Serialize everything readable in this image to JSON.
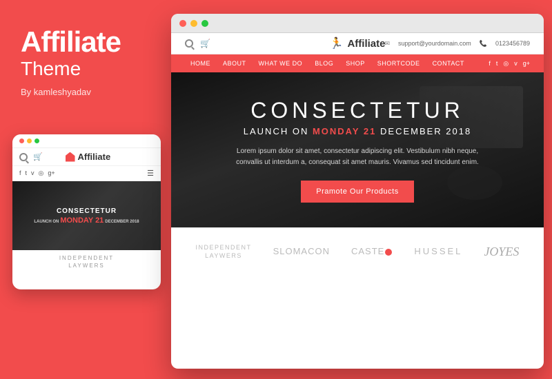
{
  "brand": {
    "title": "Affiliate",
    "subtitle": "Theme",
    "by": "By kamleshyadav"
  },
  "mobile": {
    "logo_text": "Affiliate",
    "hero_title": "CONSECTETUR",
    "hero_launch_prefix": "LAUNCH ON",
    "hero_launch_highlight": "MONDAY 21",
    "hero_launch_suffix": "DECEMBER 2018",
    "brand_bottom_line1": "INDEPENDENT",
    "brand_bottom_line2": "LAYWERS"
  },
  "desktop": {
    "logo_text": "Affiliate",
    "support_email": "support@yourdomain.com",
    "phone": "0123456789",
    "nav_links": [
      "HOME",
      "ABOUT",
      "WHAT WE DO",
      "BLOG",
      "SHOP",
      "SHORTCODE",
      "CONTACT"
    ],
    "hero_title": "CONSECTETUR",
    "hero_subtitle_prefix": "LAUNCH ON",
    "hero_subtitle_highlight": "MONDAY 21",
    "hero_subtitle_suffix": "DECEMBER 2018",
    "hero_desc": "Lorem ipsum dolor sit amet, consectetur adipiscing elit. Vestibulum nibh neque, convallis ut interdum a, consequat sit amet mauris. Vivamus sed tincidunt enim.",
    "hero_btn": "Pramote Our Products",
    "partners": [
      {
        "name": "INDEPENDENT\nLAYWERS",
        "type": "stacked"
      },
      {
        "name": "SLOMACON",
        "type": "normal"
      },
      {
        "name": "CASTEDOT",
        "type": "dot"
      },
      {
        "name": "HUSSEL",
        "type": "normal"
      },
      {
        "name": "Joyes",
        "type": "script"
      }
    ]
  }
}
